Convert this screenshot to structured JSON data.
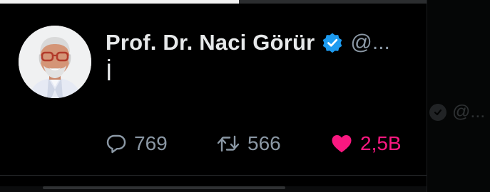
{
  "video": {
    "progress": 0.56
  },
  "tweet": {
    "display_name": "Prof. Dr. Naci Görür",
    "handle": "@...",
    "verified": true,
    "text": "İ",
    "reply_count": "769",
    "retweet_count": "566",
    "like_count": "2,5B",
    "liked": true
  },
  "background_tweet": {
    "handle": "@..."
  },
  "colors": {
    "background": "#000000",
    "text_primary": "#e7e9ea",
    "text_secondary": "#8b98a5",
    "verified_blue": "#1d9bf0",
    "like_pink": "#f91880"
  },
  "icons": {
    "avatar": "profile-photo",
    "verified": "verified-check-icon",
    "reply": "reply-bubble-icon",
    "retweet": "retweet-arrows-icon",
    "like": "heart-filled-icon"
  }
}
